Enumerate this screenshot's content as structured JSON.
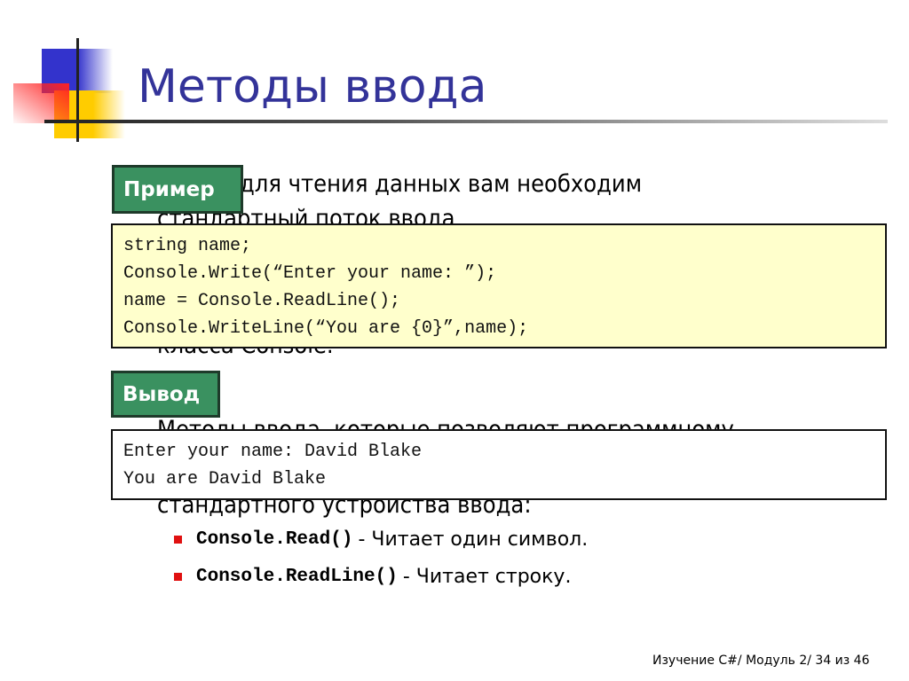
{
  "title": "Методы ввода",
  "body_fragments": [
    "для чтения данных вам необходим",
    "стандартный поток ввода",
    "класса Console.",
    "Методы ввода, которые позволяют программному",
    "стандартного устройства ввода:"
  ],
  "example": {
    "label": "Пример",
    "code_lines": [
      "string name;",
      "Console.Write(“Enter your name: ”);",
      "name = Console.ReadLine();",
      "Console.WriteLine(“You are {0}”,name);"
    ]
  },
  "output": {
    "label": "Вывод",
    "lines": [
      "Enter your name: David Blake",
      "You are David Blake"
    ]
  },
  "bullets": [
    {
      "code": "Console.Read()",
      "text": "- Читает один символ."
    },
    {
      "code": "Console.ReadLine()",
      "text": "- Читает строку."
    }
  ],
  "footer": "Изучение C#/ Модуль 2/ 34 из 46",
  "colors": {
    "title": "#333399",
    "label_bg": "#3a9160",
    "code_bg": "#ffffcc",
    "bullet": "#e01010"
  }
}
